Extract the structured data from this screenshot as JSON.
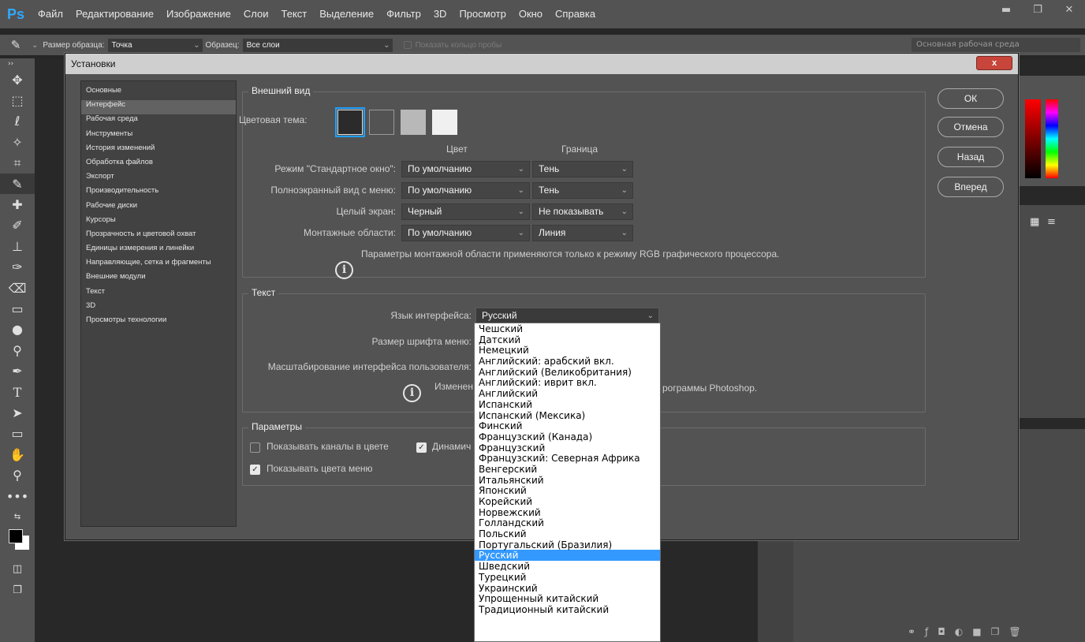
{
  "app": {
    "logo": "Ps",
    "menu": [
      "Файл",
      "Редактирование",
      "Изображение",
      "Слои",
      "Текст",
      "Выделение",
      "Фильтр",
      "3D",
      "Просмотр",
      "Окно",
      "Справка"
    ]
  },
  "optionsbar": {
    "sample_size_label": "Размер образца:",
    "sample_size_value": "Точка",
    "sample_label": "Образец:",
    "sample_value": "Все слои",
    "show_ring_label": "Показать кольцо пробы",
    "workspace": "Основная рабочая среда"
  },
  "dialog": {
    "title": "Установки",
    "close": "x",
    "sidebar": [
      "Основные",
      "Интерфейс",
      "Рабочая среда",
      "Инструменты",
      "История изменений",
      "Обработка файлов",
      "Экспорт",
      "Производительность",
      "Рабочие диски",
      "Курсоры",
      "Прозрачность и цветовой охват",
      "Единицы измерения и линейки",
      "Направляющие, сетка и фрагменты",
      "Внешние модули",
      "Текст",
      "3D",
      "Просмотры технологии"
    ],
    "sidebar_active_index": 1,
    "appearance": {
      "title": "Внешний вид",
      "theme_label": "Цветовая тема:",
      "theme_colors": [
        "#2b2b2b",
        "#535353",
        "#b8b8b8",
        "#f0f0f0"
      ],
      "col_color": "Цвет",
      "col_border": "Граница",
      "rows": [
        {
          "label": "Режим \"Стандартное окно\":",
          "color": "По умолчанию",
          "border": "Тень"
        },
        {
          "label": "Полноэкранный вид с меню:",
          "color": "По умолчанию",
          "border": "Тень"
        },
        {
          "label": "Целый экран:",
          "color": "Черный",
          "border": "Не показывать"
        },
        {
          "label": "Монтажные области:",
          "color": "По умолчанию",
          "border": "Линия"
        }
      ],
      "note": "Параметры монтажной области применяются только к режиму RGB графического процессора."
    },
    "text": {
      "title": "Текст",
      "lang_label": "Язык интерфейса:",
      "lang_value": "Русский",
      "font_size_label": "Размер шрифта меню:",
      "scale_label": "Масштабирование интерфейса пользователя:",
      "note_left": "Изменен",
      "note_right": "рограммы Photoshop."
    },
    "params": {
      "title": "Параметры",
      "cb1_label": "Показывать каналы в цвете",
      "cb2_label": "Динамич",
      "cb3_label": "Показывать цвета меню"
    },
    "buttons": {
      "ok": "ОК",
      "cancel": "Отмена",
      "back": "Назад",
      "forward": "Вперед"
    }
  },
  "language_dropdown": {
    "items": [
      "Чешский",
      "Датский",
      "Немецкий",
      "Английский: арабский вкл.",
      "Английский (Великобритания)",
      "Английский: иврит вкл.",
      "Английский",
      "Испанский",
      "Испанский (Мексика)",
      "Финский",
      "Французский (Канада)",
      "Французский",
      "Французский: Северная Африка",
      "Венгерский",
      "Итальянский",
      "Японский",
      "Корейский",
      "Норвежский",
      "Голландский",
      "Польский",
      "Португальский (Бразилия)",
      "Русский",
      "Шведский",
      "Турецкий",
      "Украинский",
      "Упрощенный китайский",
      "Традиционный китайский"
    ],
    "selected_index": 21
  }
}
